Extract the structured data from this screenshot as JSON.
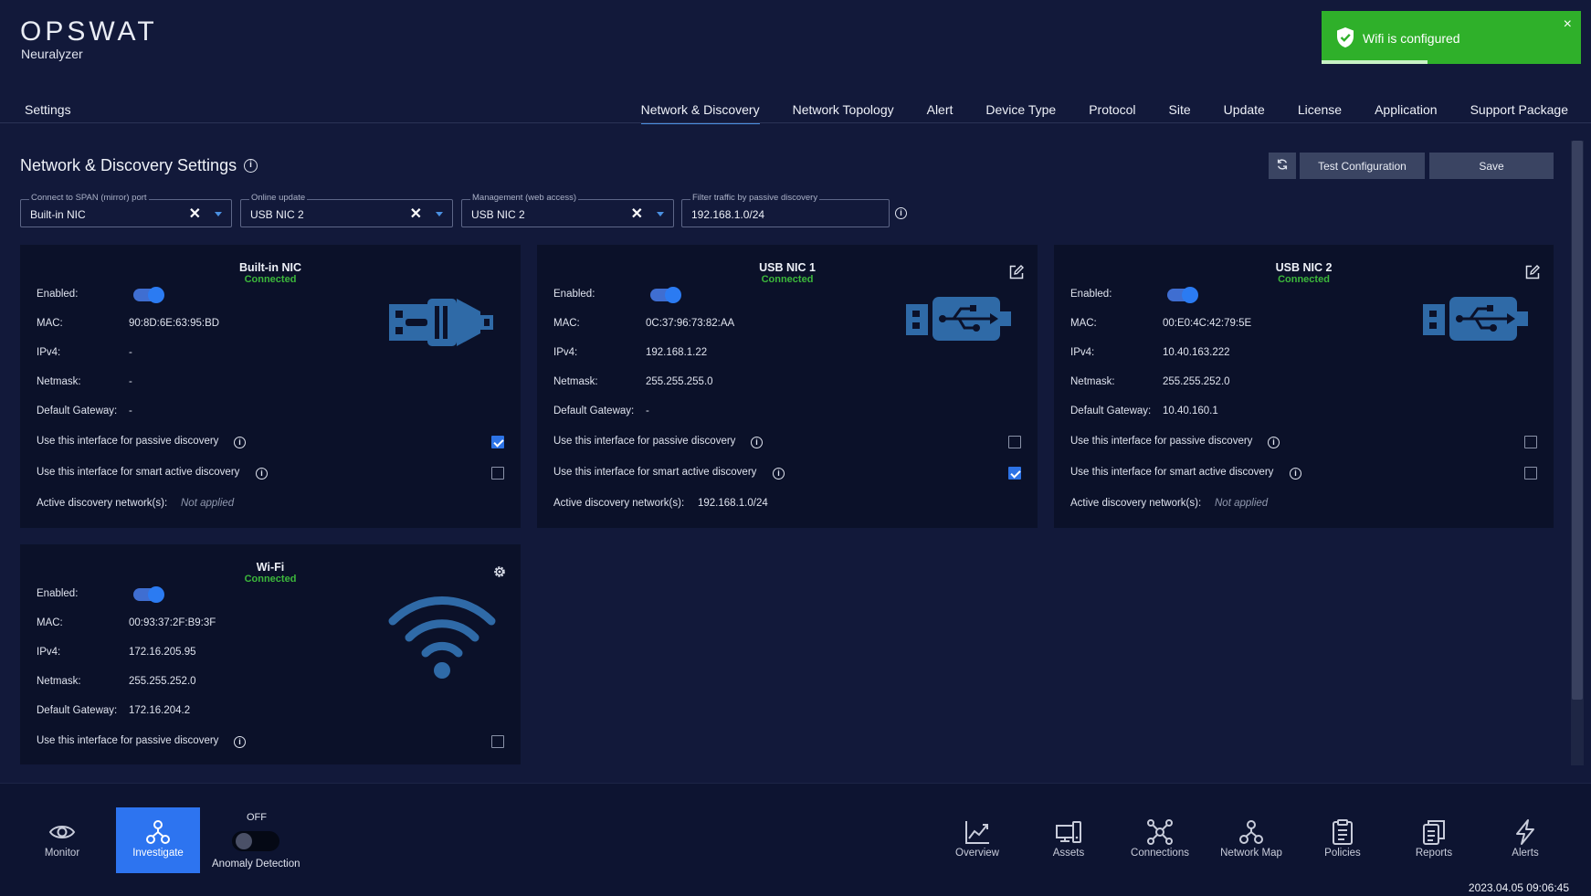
{
  "app": {
    "brand": "OPSWAT",
    "product": "Neuralyzer"
  },
  "toast": {
    "message": "Wifi is configured",
    "close": "×",
    "progress": 0.41,
    "color": "#2fb02a"
  },
  "header": {
    "settings": "Settings",
    "tabs": [
      {
        "label": "Network & Discovery",
        "active": true
      },
      {
        "label": "Network Topology"
      },
      {
        "label": "Alert"
      },
      {
        "label": "Device Type"
      },
      {
        "label": "Protocol"
      },
      {
        "label": "Site"
      },
      {
        "label": "Update"
      },
      {
        "label": "License"
      },
      {
        "label": "Application"
      },
      {
        "label": "Support Package"
      }
    ]
  },
  "page": {
    "title": "Network & Discovery Settings",
    "info": "i",
    "refresh_icon": "refresh-icon",
    "test_label": "Test Configuration",
    "save_label": "Save"
  },
  "fields": {
    "span": {
      "label": "Connect to SPAN (mirror) port",
      "value": "Built-in NIC",
      "clear": "✕"
    },
    "online": {
      "label": "Online update",
      "value": "USB NIC 2",
      "clear": "✕"
    },
    "mgmt": {
      "label": "Management (web access)",
      "value": "USB NIC 2",
      "clear": "✕"
    },
    "filter": {
      "label": "Filter traffic by passive discovery",
      "value": "192.168.1.0/24"
    }
  },
  "labels": {
    "enabled": "Enabled:",
    "mac": "MAC:",
    "ipv4": "IPv4:",
    "netmask": "Netmask:",
    "gateway": "Default Gateway:",
    "passive": "Use this interface for passive discovery",
    "smart": "Use this interface for smart active discovery",
    "networks": "Active discovery network(s):"
  },
  "cards": {
    "builtin": {
      "title": "Built-in NIC",
      "status": "Connected",
      "enabled": true,
      "mac": "90:8D:6E:63:95:BD",
      "ipv4": "-",
      "netmask": "-",
      "gateway": "-",
      "passive": true,
      "smart": false,
      "networks": "Not applied",
      "icon": "ethernet-icon"
    },
    "usb1": {
      "title": "USB NIC 1",
      "status": "Connected",
      "enabled": true,
      "mac": "0C:37:96:73:82:AA",
      "ipv4": "192.168.1.22",
      "netmask": "255.255.255.0",
      "gateway": "-",
      "passive": false,
      "smart": true,
      "networks": "192.168.1.0/24",
      "icon": "usb-icon"
    },
    "usb2": {
      "title": "USB NIC 2",
      "status": "Connected",
      "enabled": true,
      "mac": "00:E0:4C:42:79:5E",
      "ipv4": "10.40.163.222",
      "netmask": "255.255.252.0",
      "gateway": "10.40.160.1",
      "passive": false,
      "smart": false,
      "networks": "Not applied",
      "icon": "usb-icon"
    },
    "wifi": {
      "title": "Wi-Fi",
      "status": "Connected",
      "enabled": true,
      "mac": "00:93:37:2F:B9:3F",
      "ipv4": "172.16.205.95",
      "netmask": "255.255.252.0",
      "gateway": "172.16.204.2",
      "passive": false,
      "icon": "wifi-icon"
    }
  },
  "bottom": {
    "monitor": "Monitor",
    "investigate": "Investigate",
    "anomaly_state": "OFF",
    "anomaly_label": "Anomaly Detection",
    "overview": "Overview",
    "assets": "Assets",
    "connections": "Connections",
    "network_map": "Network Map",
    "policies": "Policies",
    "reports": "Reports",
    "alerts": "Alerts",
    "timestamp": "2023.04.05 09:06:45"
  },
  "colors": {
    "accent": "#2d74f0",
    "connected": "#3cb83b",
    "icon_blue": "#2f6aa7",
    "background": "#12193a"
  }
}
